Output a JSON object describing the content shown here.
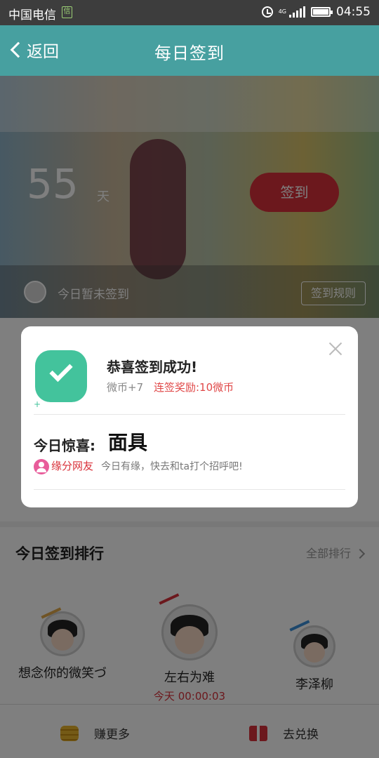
{
  "status_bar": {
    "carrier": "中国电信",
    "sim_badge": "信",
    "network": "4G",
    "time": "04:55"
  },
  "header": {
    "back_label": "返回",
    "title": "每日签到"
  },
  "hero": {
    "days_count": "55",
    "days_unit": "天",
    "sign_button": "签到",
    "status_text": "今日暂未签到",
    "rules_button": "签到规则"
  },
  "dialog": {
    "title": "恭喜签到成功!",
    "coins": "微币+7",
    "streak_reward": "连签奖励:10微币",
    "surprise_label": "今日惊喜:",
    "surprise_value": "面具",
    "fate_label": "缘分网友",
    "fate_desc": "今日有缘，快去和ta打个招呼吧!"
  },
  "ranking": {
    "title": "今日签到排行",
    "all_link": "全部排行",
    "entries": [
      {
        "name": "想念你的微笑づ",
        "time": ""
      },
      {
        "name": "左右为难",
        "time": "今天 00:00:03"
      },
      {
        "name": "李泽柳",
        "time": ""
      }
    ]
  },
  "bottom_bar": {
    "earn_label": "赚更多",
    "exchange_label": "去兑换"
  },
  "colors": {
    "header_teal": "#47a0a0",
    "success_green": "#43c39c",
    "accent_red": "#d9313a"
  }
}
